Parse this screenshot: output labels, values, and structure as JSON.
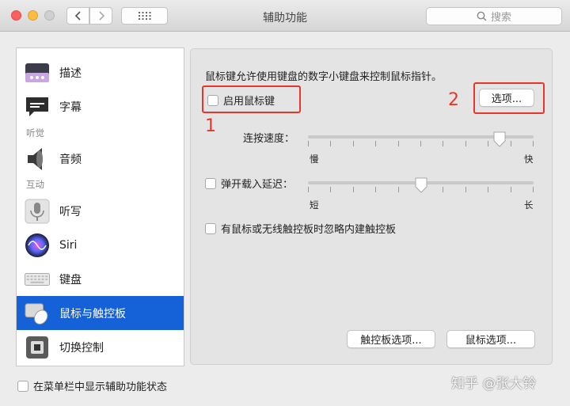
{
  "window": {
    "title": "辅助功能",
    "search_placeholder": "搜索"
  },
  "sidebar": {
    "items": [
      {
        "label": "描述",
        "icon": "description-icon"
      },
      {
        "label": "字幕",
        "icon": "captions-icon"
      },
      {
        "label": "音频",
        "icon": "speaker-icon"
      },
      {
        "label": "听写",
        "icon": "microphone-icon"
      },
      {
        "label": "Siri",
        "icon": "siri-icon"
      },
      {
        "label": "键盘",
        "icon": "keyboard-icon"
      },
      {
        "label": "鼠标与触控板",
        "icon": "mouse-trackpad-icon"
      },
      {
        "label": "切换控制",
        "icon": "switch-control-icon"
      }
    ],
    "headers": {
      "hearing": "听觉",
      "interaction": "互动"
    },
    "selected": "鼠标与触控板"
  },
  "main": {
    "description": "鼠标键允许使用键盘的数字小键盘来控制鼠标指针。",
    "enable_mouse_keys": {
      "label": "启用鼠标键",
      "checked": false
    },
    "options_button": "选项...",
    "sliders": {
      "speed": {
        "label": "连按速度：",
        "min_label": "慢",
        "max_label": "快",
        "value": 0.85
      },
      "spring_delay": {
        "label": "弹开载入延迟：",
        "min_label": "短",
        "max_label": "长",
        "value": 0.5,
        "checked": false
      }
    },
    "ignore_trackpad": {
      "label": "有鼠标或无线触控板时忽略内建触控板",
      "checked": false
    },
    "trackpad_options_button": "触控板选项...",
    "mouse_options_button": "鼠标选项..."
  },
  "footer": {
    "show_in_menubar": {
      "label": "在菜单栏中显示辅助功能状态",
      "checked": false
    }
  },
  "annotations": {
    "one": "1",
    "two": "2",
    "color": "#e8362b"
  },
  "watermark": "知乎 @张大铃",
  "colors": {
    "selection": "#1561d8"
  }
}
